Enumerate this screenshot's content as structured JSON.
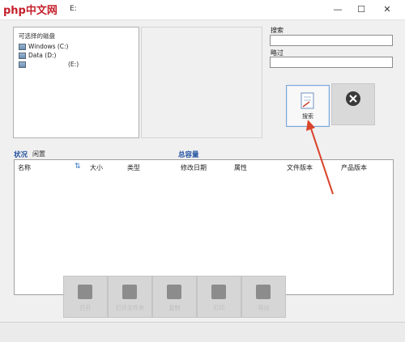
{
  "watermark": "php中文网",
  "window": {
    "title": "E:"
  },
  "drives": {
    "title": "可选择的磁盘",
    "items": [
      {
        "label": "Windows (C:)"
      },
      {
        "label": "Data (D:)"
      },
      {
        "label": "(E:)"
      }
    ]
  },
  "search": {
    "search_label": "搜索",
    "search_value": "",
    "skip_label": "略过",
    "skip_value": "",
    "search_button_label": "搜索"
  },
  "summary": {
    "status_label": "状况",
    "status_value": "闲置",
    "total_label": "总容量",
    "total_value": ""
  },
  "table": {
    "columns": [
      "名称",
      "大小",
      "类型",
      "修改日期",
      "属性",
      "文件版本",
      "产品版本"
    ],
    "rows": []
  },
  "toolbar": {
    "buttons": [
      {
        "label": "打开"
      },
      {
        "label": "打开文件夹"
      },
      {
        "label": "复制"
      },
      {
        "label": "打印"
      },
      {
        "label": "导出"
      }
    ]
  },
  "colors": {
    "accent": "#1f4e9e",
    "arrow": "#d9442b",
    "watermark": "#c41f2b"
  }
}
